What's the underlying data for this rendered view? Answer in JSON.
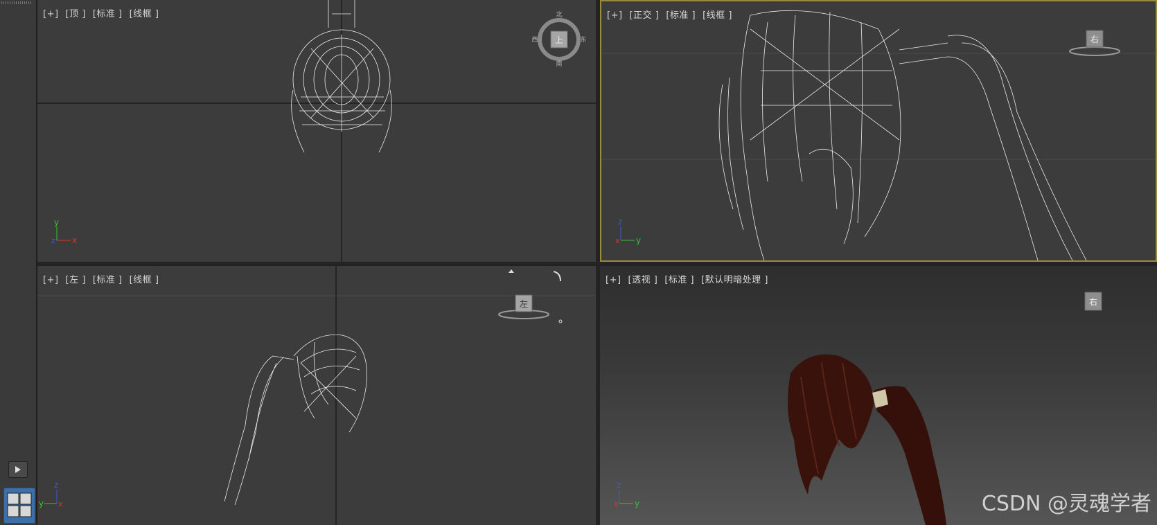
{
  "viewports": {
    "top": {
      "plus": "[+]",
      "view": "[顶 ]",
      "shading": "[标准 ]",
      "mode": "[线框 ]",
      "cube_face": "上",
      "compass_n": "北",
      "compass_s": "南",
      "compass_w": "西",
      "compass_e": "东",
      "axis_a": "y",
      "axis_b": "x",
      "axis_c": "z"
    },
    "front": {
      "plus": "[+]",
      "view": "[正交 ]",
      "shading": "[标准 ]",
      "mode": "[线框 ]",
      "cube_face": "右",
      "axis_a": "z",
      "axis_b": "y",
      "axis_c": "x"
    },
    "left": {
      "plus": "[+]",
      "view": "[左 ]",
      "shading": "[标准 ]",
      "mode": "[线框 ]",
      "cube_face": "左",
      "axis_a": "z",
      "axis_b": "y",
      "axis_c": "x"
    },
    "perspective": {
      "plus": "[+]",
      "view": "[透视 ]",
      "shading": "[标准 ]",
      "mode": "[默认明暗处理 ]",
      "cube_face": "右",
      "axis_a": "z",
      "axis_b": "y",
      "axis_c": "x"
    }
  },
  "watermark": "CSDN @灵魂学者",
  "colors": {
    "active_border": "#9c8a3c",
    "wire": "#ffffff",
    "hair": "#3a120c",
    "axis_x": "#d23a2a",
    "axis_y": "#3ac23a",
    "axis_z": "#3a5ad2"
  },
  "icons": {
    "play": "play-icon",
    "layout": "viewport-layout-icon"
  }
}
